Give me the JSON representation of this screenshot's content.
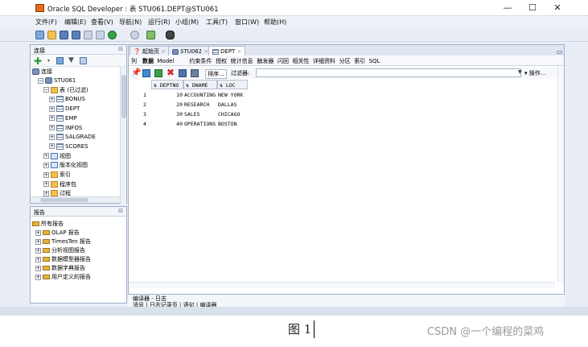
{
  "window": {
    "title": "Oracle SQL Developer : 表 STU061.DEPT@STU061",
    "minimize": "—",
    "maximize": "☐",
    "close": "✕"
  },
  "menus": [
    "文件(F)",
    "编辑(E)",
    "查看(V)",
    "导航(N)",
    "运行(R)",
    "小组(M)",
    "工具(T)",
    "窗口(W)",
    "帮助(H)"
  ],
  "connections_pane": {
    "title": "连接",
    "root": "连接",
    "tree": [
      {
        "label": "STU061",
        "kind": "db",
        "level": 1,
        "exp": "−"
      },
      {
        "label": "表 (已过滤)",
        "kind": "fold",
        "level": 2,
        "exp": "−"
      },
      {
        "label": "BONUS",
        "kind": "tbl",
        "level": 3,
        "exp": "+"
      },
      {
        "label": "DEPT",
        "kind": "tbl",
        "level": 3,
        "exp": "+"
      },
      {
        "label": "EMP",
        "kind": "tbl",
        "level": 3,
        "exp": "+"
      },
      {
        "label": "INFOS",
        "kind": "tbl",
        "level": 3,
        "exp": "+"
      },
      {
        "label": "SALGRADE",
        "kind": "tbl",
        "level": 3,
        "exp": "+"
      },
      {
        "label": "SCORES",
        "kind": "tbl",
        "level": 3,
        "exp": "+"
      },
      {
        "label": "视图",
        "kind": "view",
        "level": 2,
        "exp": "+"
      },
      {
        "label": "版本化视图",
        "kind": "view",
        "level": 2,
        "exp": "+"
      },
      {
        "label": "索引",
        "kind": "fold",
        "level": 2,
        "exp": "+"
      },
      {
        "label": "程序包",
        "kind": "fold",
        "level": 2,
        "exp": "+"
      },
      {
        "label": "过程",
        "kind": "fold",
        "level": 2,
        "exp": "+"
      }
    ]
  },
  "reports_pane": {
    "title": "报告",
    "root": "所有报告",
    "items": [
      "OLAP 报告",
      "TimesTen 报告",
      "分析视图报告",
      "数据模型器报告",
      "数据字典报告",
      "用户定义的报告"
    ]
  },
  "doc_tabs": [
    {
      "label": "起始页",
      "active": false
    },
    {
      "label": "STU061",
      "active": false
    },
    {
      "label": "DEPT",
      "active": true
    }
  ],
  "sub_tabs": [
    "列",
    "数据",
    "Model",
    "约束条件",
    "授权",
    "统计信息",
    "触发器",
    "闪回",
    "相关性",
    "详细资料",
    "分区",
    "索引",
    "SQL"
  ],
  "grid_toolbar": {
    "sort_label": "排序...",
    "filter_label": "过滤器:",
    "filter_value": "",
    "actions_label": "操作..."
  },
  "grid": {
    "columns": [
      "DEPTNO",
      "DNAME",
      "LOC"
    ],
    "rows": [
      {
        "n": "1",
        "deptno": "10",
        "dname": "ACCOUNTING",
        "loc": "NEW YORK"
      },
      {
        "n": "2",
        "deptno": "20",
        "dname": "RESEARCH",
        "loc": "DALLAS"
      },
      {
        "n": "3",
        "deptno": "30",
        "dname": "SALES",
        "loc": "CHICAGO"
      },
      {
        "n": "4",
        "deptno": "40",
        "dname": "OPERATIONS",
        "loc": "BOSTON"
      }
    ]
  },
  "log_pane": {
    "title": "编译器 - 日志",
    "tabs": [
      "消息",
      "日志记录页",
      "语句",
      "编译器"
    ]
  },
  "caption": "图 1",
  "watermark": "CSDN @一个编程的菜鸡",
  "colors": {
    "accent": "#e46b1e",
    "pane_border": "#9fb0c8",
    "window_bg": "#e9eef6"
  }
}
